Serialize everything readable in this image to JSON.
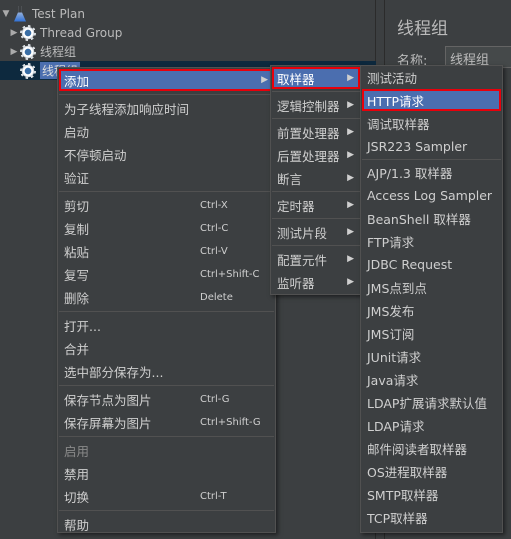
{
  "tree": [
    {
      "label": "Test Plan",
      "icon": "flask-icon",
      "expanded": true
    },
    {
      "label": "Thread Group",
      "icon": "gear-icon",
      "expanded": false
    },
    {
      "label": "线程组",
      "icon": "gear-icon",
      "expanded": false
    },
    {
      "label": "线程组",
      "icon": "gear-icon",
      "selected": true
    }
  ],
  "panel": {
    "title": "线程组",
    "name_label": "名称:",
    "name_value": "线程组"
  },
  "colors": {
    "background": "#3c3f41",
    "highlight": "#4b6eaf",
    "focus_outline": "#e8000b"
  },
  "menu1": [
    {
      "label": "添加",
      "submenu": true,
      "hl": true
    },
    {
      "label": "为子线程添加响应时间",
      "sep": true
    },
    {
      "label": "启动"
    },
    {
      "label": "不停顿启动"
    },
    {
      "label": "验证"
    },
    {
      "label": "剪切",
      "shortcut": "Ctrl-X",
      "sep": true
    },
    {
      "label": "复制",
      "shortcut": "Ctrl-C"
    },
    {
      "label": "粘贴",
      "shortcut": "Ctrl-V"
    },
    {
      "label": "复写",
      "shortcut": "Ctrl+Shift-C"
    },
    {
      "label": "删除",
      "shortcut": "Delete"
    },
    {
      "label": "打开...",
      "sep": true
    },
    {
      "label": "合并"
    },
    {
      "label": "选中部分保存为..."
    },
    {
      "label": "保存节点为图片",
      "shortcut": "Ctrl-G",
      "sep": true
    },
    {
      "label": "保存屏幕为图片",
      "shortcut": "Ctrl+Shift-G"
    },
    {
      "label": "启用",
      "disabled": true,
      "sep": true
    },
    {
      "label": "禁用"
    },
    {
      "label": "切换",
      "shortcut": "Ctrl-T"
    },
    {
      "label": "帮助",
      "sep": true
    }
  ],
  "menu2": [
    {
      "label": "取样器",
      "submenu": true,
      "hl": true
    },
    {
      "label": "逻辑控制器",
      "submenu": true,
      "sep": true
    },
    {
      "label": "前置处理器",
      "submenu": true,
      "sep": true
    },
    {
      "label": "后置处理器",
      "submenu": true
    },
    {
      "label": "断言",
      "submenu": true
    },
    {
      "label": "定时器",
      "submenu": true,
      "sep": true
    },
    {
      "label": "测试片段",
      "submenu": true,
      "sep": true
    },
    {
      "label": "配置元件",
      "submenu": true,
      "sep": true
    },
    {
      "label": "监听器",
      "submenu": true
    }
  ],
  "menu3": [
    {
      "label": "测试活动"
    },
    {
      "label": "HTTP请求",
      "hl": true
    },
    {
      "label": "调试取样器"
    },
    {
      "label": "JSR223 Sampler"
    },
    {
      "label": "AJP/1.3 取样器",
      "sep": true
    },
    {
      "label": "Access Log Sampler"
    },
    {
      "label": "BeanShell 取样器"
    },
    {
      "label": "FTP请求"
    },
    {
      "label": "JDBC Request"
    },
    {
      "label": "JMS点到点"
    },
    {
      "label": "JMS发布"
    },
    {
      "label": "JMS订阅"
    },
    {
      "label": "JUnit请求"
    },
    {
      "label": "Java请求"
    },
    {
      "label": "LDAP扩展请求默认值"
    },
    {
      "label": "LDAP请求"
    },
    {
      "label": "邮件阅读者取样器"
    },
    {
      "label": "OS进程取样器"
    },
    {
      "label": "SMTP取样器"
    },
    {
      "label": "TCP取样器"
    }
  ]
}
